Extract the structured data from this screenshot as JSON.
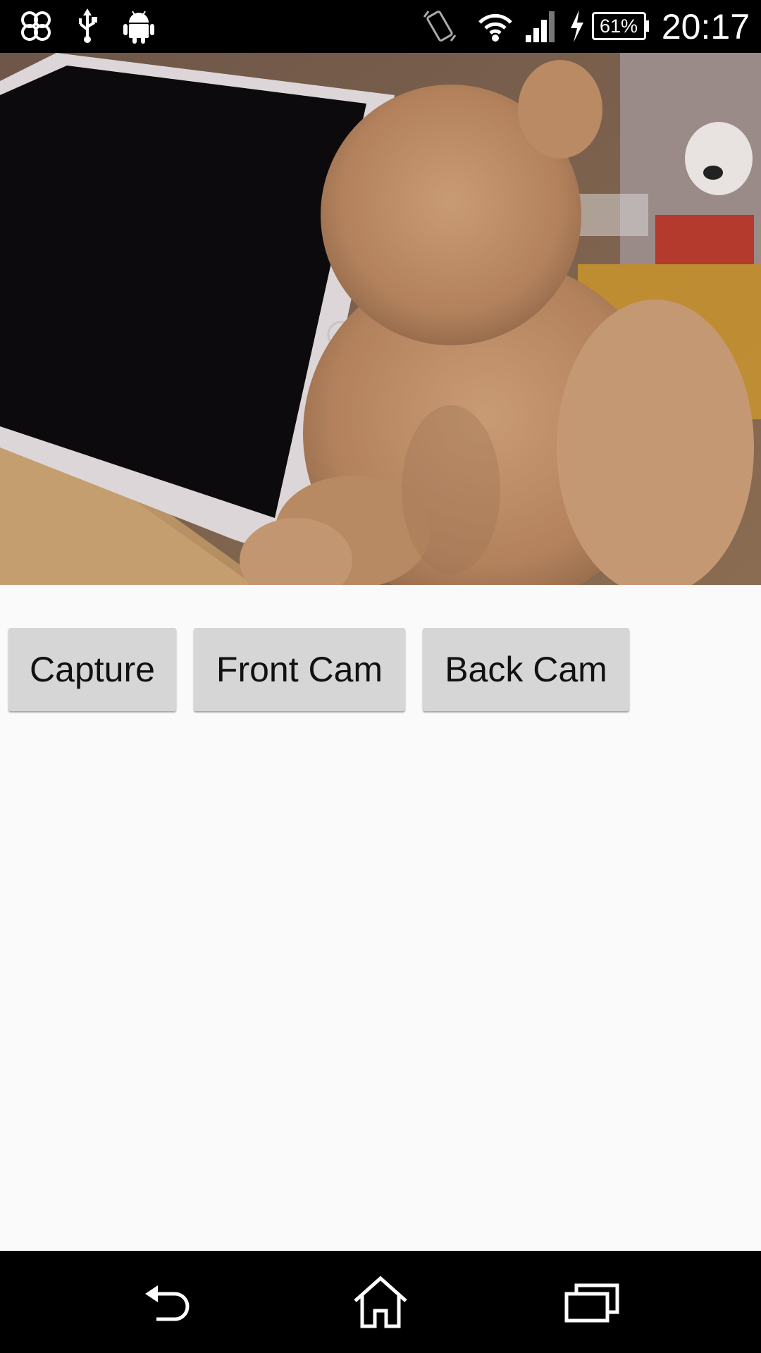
{
  "status_bar": {
    "time": "20:17",
    "battery_percent": "61%",
    "icons": [
      "app-notification-icon",
      "usb-icon",
      "android-debug-icon",
      "vibrate-icon",
      "wifi-icon",
      "signal-icon",
      "charging-icon",
      "battery-icon"
    ]
  },
  "camera": {
    "preview_icon": "camera-preview"
  },
  "buttons": {
    "capture_label": "Capture",
    "front_cam_label": "Front Cam",
    "back_cam_label": "Back Cam"
  },
  "nav_bar": {
    "icons": [
      "back-icon",
      "home-icon",
      "recents-icon"
    ]
  },
  "colors": {
    "status_bar_bg": "#000000",
    "page_bg": "#fafafa",
    "button_bg": "#d6d6d6",
    "nav_bar_bg": "#000000"
  }
}
